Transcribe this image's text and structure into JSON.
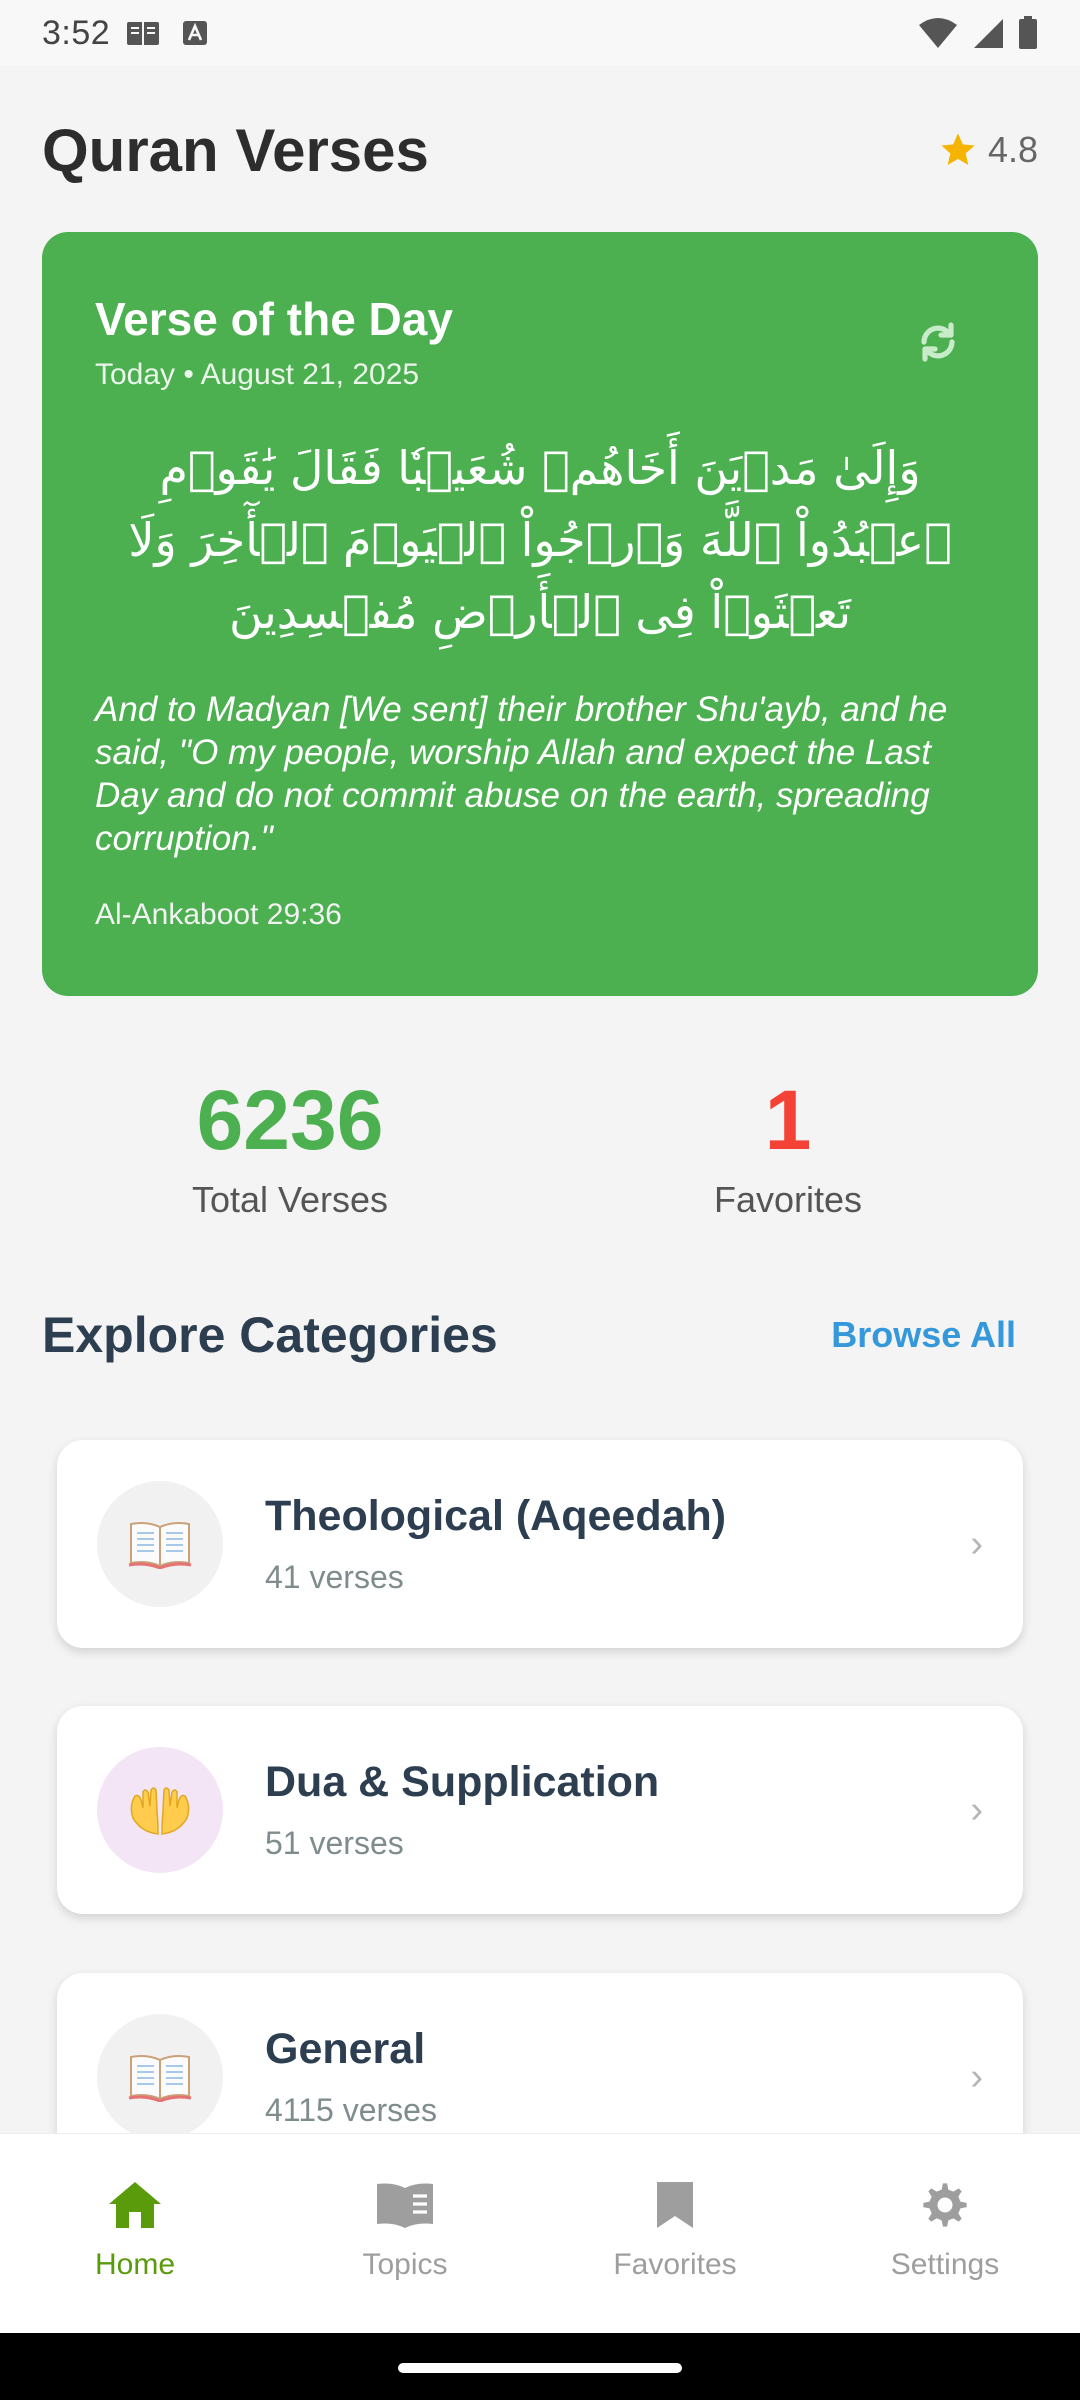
{
  "status_bar": {
    "time": "3:52",
    "left_icons": [
      "book-icon",
      "a-box-icon"
    ],
    "right_icons": [
      "wifi-icon",
      "signal-icon",
      "battery-icon"
    ]
  },
  "header": {
    "title": "Quran Verses",
    "rating": "4.8",
    "rating_icon": "star-icon",
    "rating_color": "#f5b400"
  },
  "verse_card": {
    "title": "Verse of the Day",
    "date": "Today • August 21, 2025",
    "arabic": "وَإِلَىٰ مَدۡيَنَ أَخَاهُمۡ شُعَيۡبٗا فَقَالَ يَٰقَوۡمِ ٱعۡبُدُواْ ٱللَّهَ وَٱرۡجُواْ ٱلۡيَوۡمَ ٱلۡأٓخِرَ وَلَا تَعۡثَوۡاْ فِى ٱلۡأَرۡضِ مُفۡسِدِينَ",
    "translation": "And to Madyan [We sent] their brother Shu'ayb, and he said, \"O my people, worship Allah and expect the Last Day and do not commit abuse on the earth, spreading corruption.\"",
    "reference": "Al-Ankaboot 29:36",
    "background_color": "#4caf50",
    "refresh_icon": "refresh-icon"
  },
  "stats": {
    "total_verses": "6236",
    "total_label": "Total Verses",
    "favorites": "1",
    "favorites_label": "Favorites"
  },
  "categories": {
    "title": "Explore Categories",
    "browse_all": "Browse All",
    "items": [
      {
        "name": "Theological (Aqeedah)",
        "count": "41 verses",
        "icon": "open-book-icon"
      },
      {
        "name": "Dua & Supplication",
        "count": "51 verses",
        "icon": "praying-hands-icon"
      },
      {
        "name": "General",
        "count": "4115 verses",
        "icon": "open-book-icon"
      }
    ],
    "chevron": "›"
  },
  "bottom_nav": {
    "items": [
      {
        "label": "Home",
        "icon": "home-icon",
        "active": true
      },
      {
        "label": "Topics",
        "icon": "open-book-icon",
        "active": false
      },
      {
        "label": "Favorites",
        "icon": "bookmark-icon",
        "active": false
      },
      {
        "label": "Settings",
        "icon": "gear-icon",
        "active": false
      }
    ],
    "active_color": "#5a9b0b",
    "inactive_color": "#9e9e9e"
  }
}
